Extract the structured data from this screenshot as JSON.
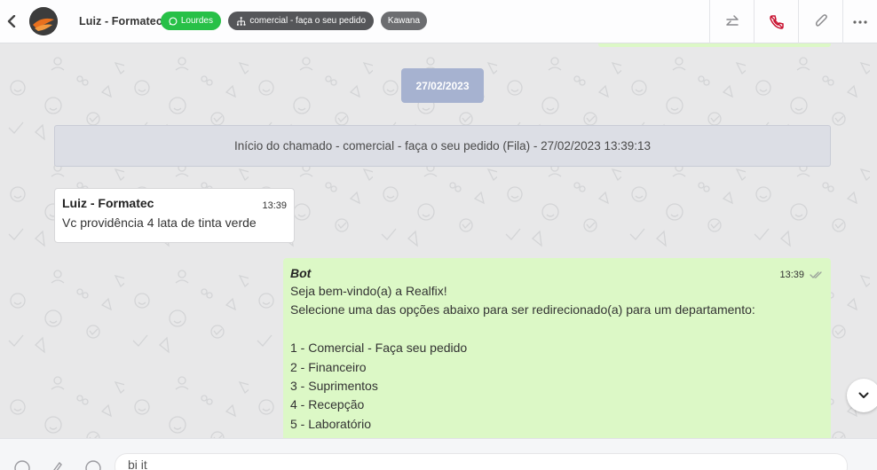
{
  "header": {
    "contact_name": "Luiz - Formatec",
    "tags": {
      "user": "Lourdes",
      "queue": "comercial - faça o seu pedido",
      "extra": "Kawana"
    },
    "icons": [
      "back-icon",
      "transfer-icon",
      "end-call-icon",
      "attachment-icon",
      "more-icon"
    ],
    "colors": {
      "user_tag": "#27c047",
      "queue_tag": "#555659",
      "extra_tag": "#6c6d70",
      "end_call": "#c8102e"
    }
  },
  "chat": {
    "date_divider": "27/02/2023",
    "system_message": "Início do chamado - comercial - faça o seu pedido (Fila) - 27/02/2023 13:39:13",
    "incoming": {
      "author": "Luiz - Formatec",
      "time": "13:39",
      "text": "Vc providência 4 lata de tinta verde"
    },
    "outgoing": {
      "author": "Bot",
      "time": "13:39",
      "lines": [
        "Seja bem-vindo(a) a Realfix!",
        "Selecione uma das opções abaixo para ser redirecionado(a) para um departamento:",
        "",
        "1 - Comercial - Faça seu pedido",
        "2 - Financeiro",
        "3 - Suprimentos",
        "4 - Recepção",
        "5 - Laboratório"
      ]
    },
    "colors": {
      "outgoing_bubble": "#dcf8c6",
      "date_pill": "#a6b2d0",
      "system_bg": "#dcdee5"
    }
  },
  "composer": {
    "input_value": "bi it",
    "icons": [
      "emoji-icon",
      "microphone-icon",
      "clock-icon"
    ]
  }
}
